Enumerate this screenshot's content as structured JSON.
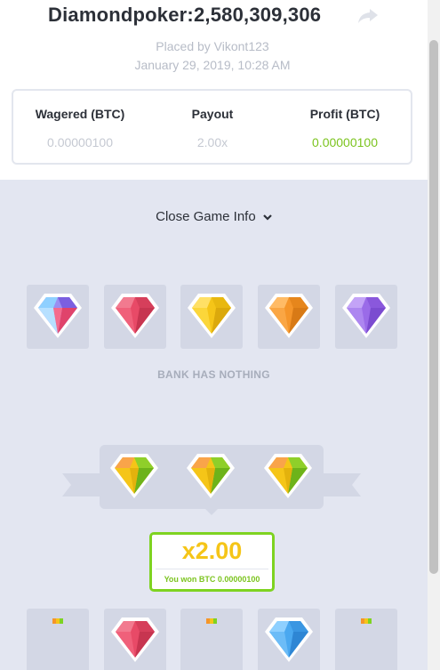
{
  "header": {
    "title": "Diamondpoker:2,580,309,306",
    "placed_by": "Placed by Vikont123",
    "date": "January 29, 2019, 10:28 AM"
  },
  "stats": {
    "wagered_label": "Wagered (BTC)",
    "wagered_value": "0.00000100",
    "payout_label": "Payout",
    "payout_value": "2.00x",
    "profit_label": "Profit (BTC)",
    "profit_value": "0.00000100"
  },
  "game": {
    "toggle_label": "Close Game Info",
    "bank_label": "BANK HAS NOTHING",
    "multiplier": "x2.00",
    "won_text": "You won BTC 0.00000100",
    "bank_gems": [
      "multicolor-gem-icon",
      "red-gem-icon",
      "yellow-gem-icon",
      "orange-gem-icon",
      "purple-gem-icon"
    ],
    "result_gems": [
      "yellow-green-gem-icon",
      "yellow-green-gem-icon",
      "yellow-green-gem-icon"
    ],
    "player_slots": [
      "empty",
      "red-gem-icon",
      "empty",
      "blue-gem-icon",
      "empty"
    ]
  },
  "colors": {
    "profit_green": "#7cc41f",
    "multiplier_yellow": "#f5c518",
    "win_border": "#7ed321",
    "game_bg": "#e3e6f1",
    "slot_bg": "#d3d7e5"
  }
}
